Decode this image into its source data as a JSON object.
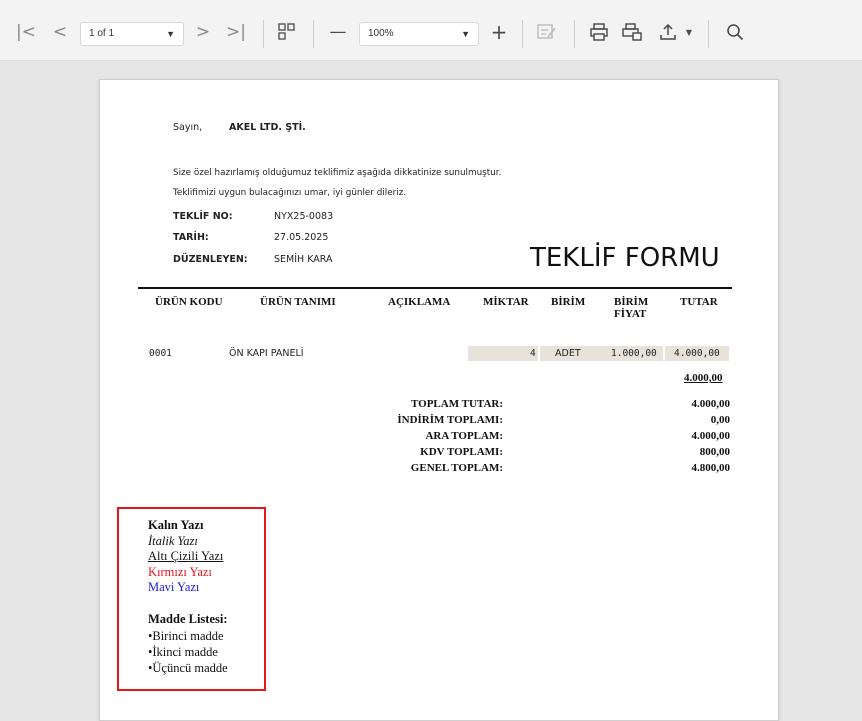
{
  "toolbar": {
    "page_select": "1 of 1",
    "zoom_select": "100%",
    "icons": {
      "first": "first-page-icon",
      "prev": "prev-page-icon",
      "next": "next-page-icon",
      "last": "last-page-icon",
      "thumbs": "thumbnails-icon",
      "zoom_out": "zoom-out-icon",
      "zoom_in": "zoom-in-icon",
      "edit": "edit-form-icon",
      "print": "print-icon",
      "print_page": "print-page-icon",
      "export": "export-icon",
      "search": "search-icon"
    }
  },
  "document": {
    "greeting_label": "Sayın,",
    "customer": "AKEL LTD. ŞTİ.",
    "intro_line1": "Size özel hazırlamış olduğumuz teklifimiz aşağıda dikkatinize sunulmuştur.",
    "intro_line2": "Teklifimizi uygun bulacağınızı umar, iyi günler dileriz.",
    "meta": [
      {
        "label": "TEKLİF NO:",
        "value": "NYX25-0083"
      },
      {
        "label": "TARİH:",
        "value": "27.05.2025"
      },
      {
        "label": "DÜZENLEYEN:",
        "value": "SEMİH KARA"
      }
    ],
    "title": "TEKLİF FORMU",
    "columns": [
      "ÜRÜN KODU",
      "ÜRÜN TANIMI",
      "AÇIKLAMA",
      "MİKTAR",
      "BİRİM",
      "BİRİM FİYAT",
      "TUTAR"
    ],
    "column_birim_fiyat_line1": "BİRİM",
    "column_birim_fiyat_line2": "FİYAT",
    "rows": [
      {
        "code": "0001",
        "name": "ÖN KAPI PANELİ",
        "desc": "",
        "qty": "4",
        "unit": "ADET",
        "price": "1.000,00",
        "total": "4.000,00"
      }
    ],
    "subtotal": "4.000,00",
    "totals": [
      {
        "label": "TOPLAM TUTAR:",
        "value": "4.000,00"
      },
      {
        "label": "İNDİRİM TOPLAMI:",
        "value": "0,00"
      },
      {
        "label": "ARA TOPLAM:",
        "value": "4.000,00"
      },
      {
        "label": "KDV TOPLAMI:",
        "value": "800,00"
      },
      {
        "label": "GENEL TOPLAM:",
        "value": "4.800,00"
      }
    ],
    "notes": {
      "bold": "Kalın Yazı",
      "italic": "İtalik Yazı",
      "underline": "Altı Çizili Yazı",
      "red": "Kırmızı Yazı",
      "blue": "Mavi Yazı",
      "list_title": "Madde Listesi:",
      "items": [
        "•Birinci madde",
        "•İkinci madde",
        "•Üçüncü madde"
      ],
      "red_color": "#e8161b",
      "blue_color": "#1a1ae6",
      "box_color": "#e8161b"
    }
  }
}
